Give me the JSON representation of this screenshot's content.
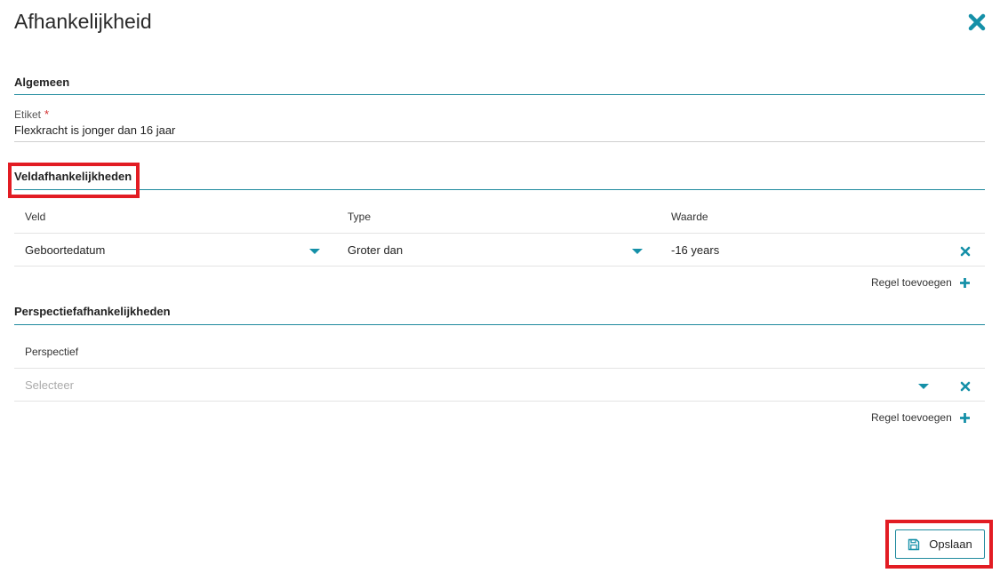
{
  "dialog": {
    "title": "Afhankelijkheid"
  },
  "sections": {
    "algemeen": "Algemeen",
    "veldafhankelijkheden": "Veldafhankelijkheden",
    "perspectiefafhankelijkheden": "Perspectiefafhankelijkheden"
  },
  "etiket": {
    "label": "Etiket",
    "required_mark": "*",
    "value": "Flexkracht is jonger dan 16 jaar"
  },
  "field_table": {
    "headers": [
      "Veld",
      "Type",
      "Waarde"
    ],
    "rows": [
      {
        "veld": "Geboortedatum",
        "type": "Groter dan",
        "waarde": "-16 years"
      }
    ],
    "add_rule_label": "Regel toevoegen"
  },
  "perspective_table": {
    "header": "Perspectief",
    "placeholder": "Selecteer",
    "add_rule_label": "Regel toevoegen"
  },
  "footer": {
    "save_label": "Opslaan"
  },
  "colors": {
    "accent": "#1590a8",
    "highlight": "#e21c23",
    "required": "#d32f2f"
  },
  "icons": {
    "close": "close-icon",
    "dropdown": "chevron-down-icon",
    "remove": "remove-row-icon",
    "add": "plus-icon",
    "save": "floppy-disk-icon"
  }
}
